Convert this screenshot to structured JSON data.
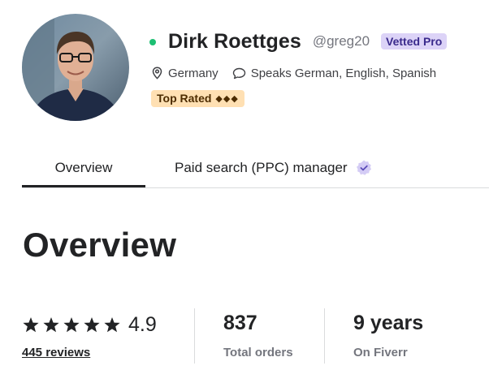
{
  "profile": {
    "name": "Dirk Roettges",
    "handle": "@greg20",
    "vetted_label": "Vetted Pro",
    "location": "Germany",
    "languages": "Speaks German, English, Spanish",
    "top_rated_label": "Top Rated",
    "top_rated_diamonds": "◆◆◆",
    "online_status_color": "#1dbf73"
  },
  "tabs": [
    {
      "label": "Overview",
      "active": true
    },
    {
      "label": "Paid search (PPC) manager",
      "active": false
    }
  ],
  "overview": {
    "title": "Overview",
    "rating": "4.9",
    "stars": 5,
    "reviews_link": "445 reviews",
    "orders_value": "837",
    "orders_label": "Total orders",
    "years_value": "9 years",
    "years_label": "On Fiverr"
  },
  "colors": {
    "text": "#222325",
    "muted": "#74767e",
    "vetted_bg": "#dcd3f7",
    "top_rated_bg": "#ffe0b3",
    "badge": "#6b58cc"
  },
  "icons": {
    "location": "location-pin-icon",
    "languages": "speech-bubble-icon",
    "verified": "verified-badge-icon",
    "star": "star-icon"
  }
}
